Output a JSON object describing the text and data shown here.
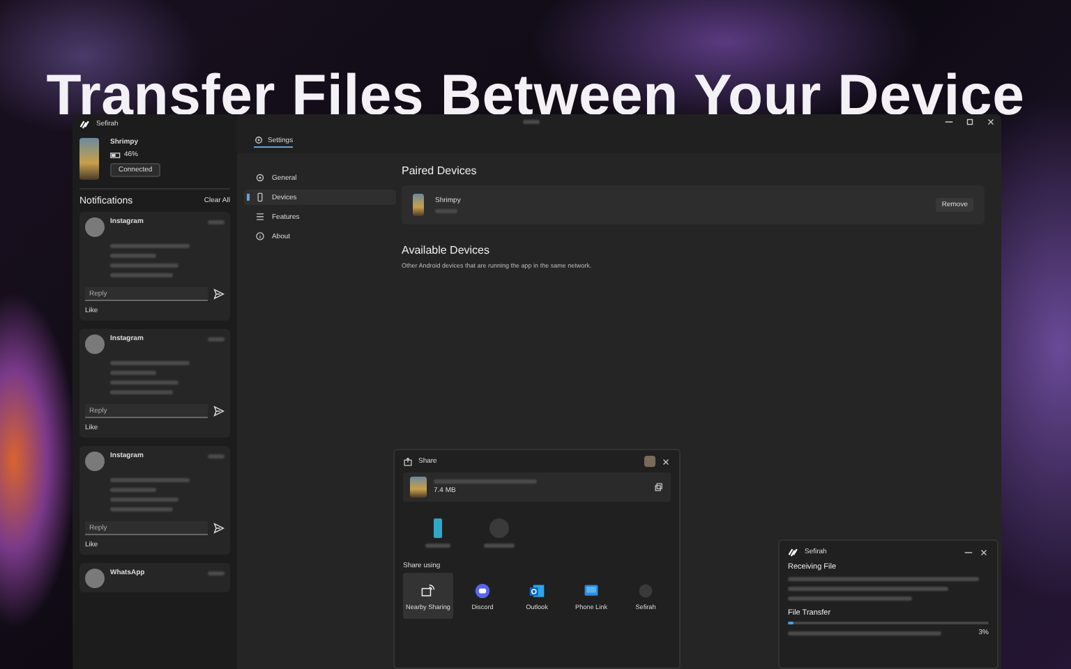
{
  "headline": "Transfer Files Between Your Device",
  "app": {
    "title": "Sefirah",
    "device": {
      "name": "Shrimpy",
      "battery": "46%",
      "status": "Connected"
    },
    "notifications": {
      "title": "Notifications",
      "clear": "Clear All",
      "items": [
        {
          "app": "Instagram",
          "reply_placeholder": "Reply",
          "like": "Like"
        },
        {
          "app": "Instagram",
          "reply_placeholder": "Reply",
          "like": "Like"
        },
        {
          "app": "Instagram",
          "reply_placeholder": "Reply",
          "like": "Like"
        },
        {
          "app": "WhatsApp"
        }
      ]
    }
  },
  "settings": {
    "tab": "Settings",
    "nav": [
      {
        "label": "General",
        "selected": false,
        "kind": "gear"
      },
      {
        "label": "Devices",
        "selected": true,
        "kind": "phone"
      },
      {
        "label": "Features",
        "selected": false,
        "kind": "list"
      },
      {
        "label": "About",
        "selected": false,
        "kind": "info"
      }
    ],
    "paired": {
      "title": "Paired Devices",
      "devices": [
        {
          "name": "Shrimpy",
          "action": "Remove"
        }
      ]
    },
    "available": {
      "title": "Available Devices",
      "description": "Other Android devices that are running the app in the same network."
    }
  },
  "share": {
    "title": "Share",
    "file_size": "7.4 MB",
    "section": "Share using",
    "apps": [
      {
        "label": "Nearby Sharing",
        "selected": true,
        "kind": "nearby"
      },
      {
        "label": "Discord",
        "selected": false,
        "kind": "discord"
      },
      {
        "label": "Outlook",
        "selected": false,
        "kind": "outlook"
      },
      {
        "label": "Phone Link",
        "selected": false,
        "kind": "phonelink"
      },
      {
        "label": "Sefirah",
        "selected": false,
        "kind": "sefirah"
      }
    ]
  },
  "transfer": {
    "title": "Sefirah",
    "heading": "Receiving File",
    "progress_label": "File Transfer",
    "level": 0.03,
    "percent": "3%"
  }
}
